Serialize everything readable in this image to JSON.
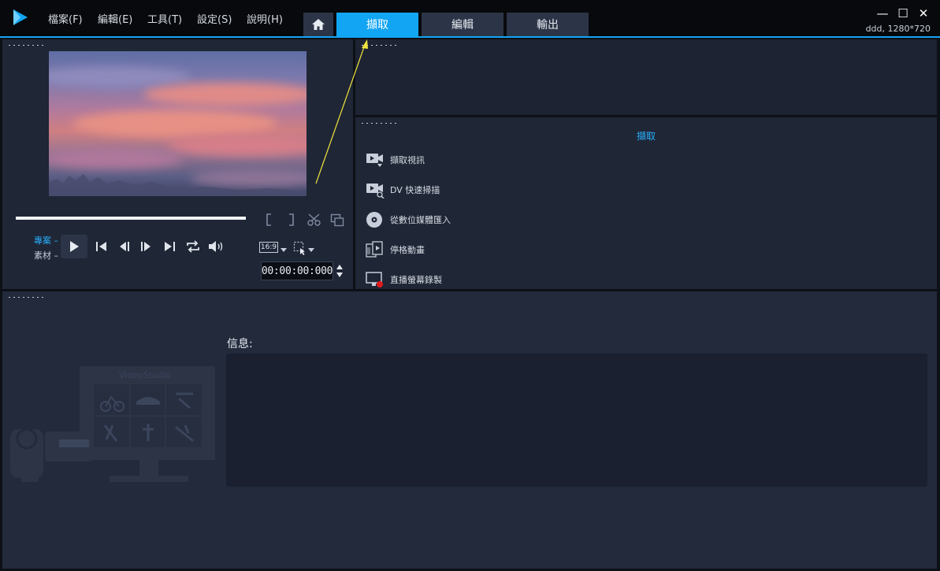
{
  "menu": [
    {
      "label": "檔案(F)"
    },
    {
      "label": "編輯(E)"
    },
    {
      "label": "工具(T)"
    },
    {
      "label": "設定(S)"
    },
    {
      "label": "說明(H)"
    }
  ],
  "tabs": {
    "home_icon": "home-icon",
    "capture": "擷取",
    "edit": "編輯",
    "output": "輸出",
    "active": "capture"
  },
  "window": {
    "minimize": "—",
    "maximize": "☐",
    "close": "✕",
    "project_info": "ddd, 1280*720"
  },
  "player": {
    "mode_project": "專案",
    "mode_clip": "素材",
    "aspect_ratio": "16:9",
    "timecode": "00:00:00:000"
  },
  "capture": {
    "header": "擷取",
    "items": [
      {
        "label": "擷取視訊",
        "icon": "capture-video-icon"
      },
      {
        "label": "DV 快速掃描",
        "icon": "dv-scan-icon"
      },
      {
        "label": "從數位媒體匯入",
        "icon": "disc-import-icon"
      },
      {
        "label": "停格動畫",
        "icon": "stop-motion-icon"
      },
      {
        "label": "直播螢幕錄製",
        "icon": "screen-record-icon"
      }
    ]
  },
  "info": {
    "label": "信息:",
    "message": ""
  },
  "watermark": {
    "title": "VideoStudio"
  },
  "colors": {
    "accent": "#12a5f3",
    "panel": "#1f2636",
    "background": "#0d1016",
    "annotation": "#f1e33d"
  }
}
